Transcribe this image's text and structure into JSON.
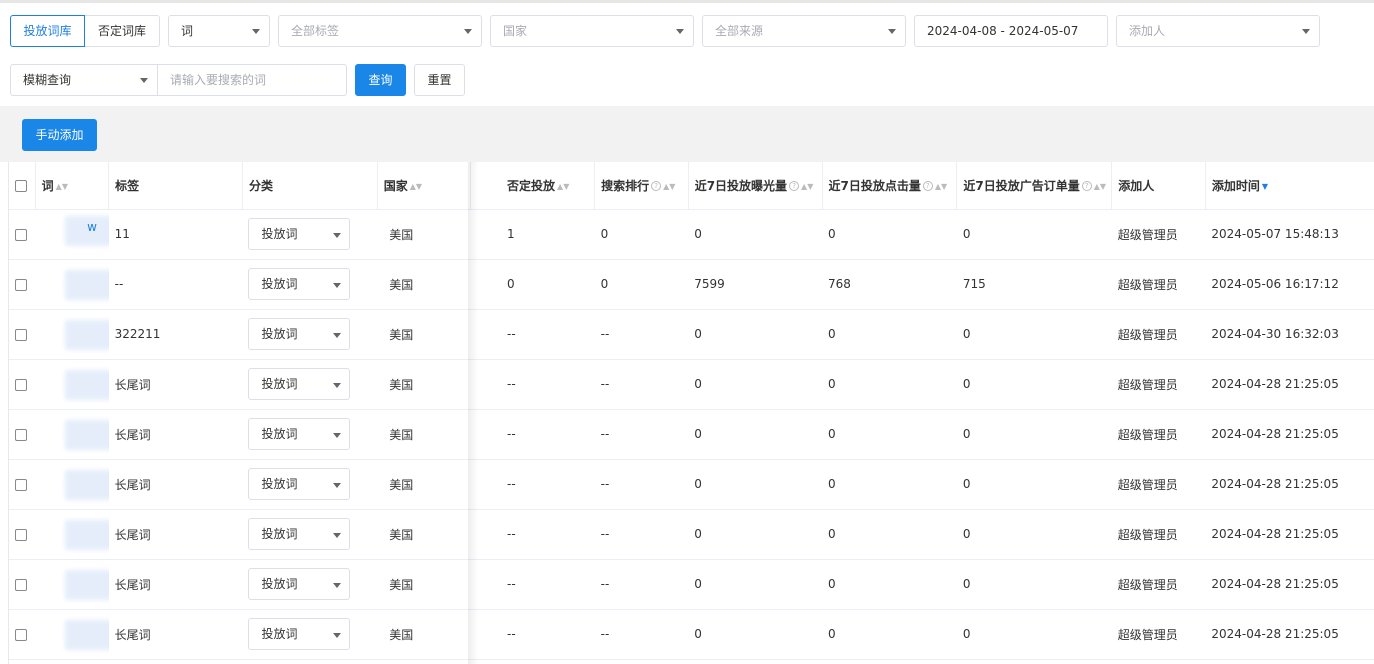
{
  "library_tabs": {
    "active": "投放词库",
    "other": "否定词库"
  },
  "filters": {
    "word_select": "词",
    "tag_select": "全部标签",
    "country_select": "国家",
    "source_select": "全部来源",
    "date_range": "2024-04-08 - 2024-05-07",
    "adder_select": "添加人",
    "match_mode": "模糊查询",
    "search_placeholder": "请输入要搜索的词",
    "query_button": "查询",
    "reset_button": "重置"
  },
  "toolbar": {
    "manual_add": "手动添加"
  },
  "columns": {
    "word": "词",
    "tag": "标签",
    "category": "分类",
    "country": "国家",
    "negative": "否定投放",
    "search_rank": "搜索排行",
    "impressions_7d": "近7日投放曝光量",
    "clicks_7d": "近7日投放点击量",
    "orders_7d": "近7日投放广告订单量",
    "adder": "添加人",
    "added_time": "添加时间"
  },
  "rows": [
    {
      "word": "w",
      "tag": "11",
      "category": "投放词",
      "country": "美国",
      "negative": "1",
      "search_rank": "0",
      "impressions": "0",
      "clicks": "0",
      "orders": "0",
      "adder": "超级管理员",
      "time": "2024-05-07 15:48:13"
    },
    {
      "word": "",
      "tag": "--",
      "category": "投放词",
      "country": "美国",
      "negative": "0",
      "search_rank": "0",
      "impressions": "7599",
      "clicks": "768",
      "orders": "715",
      "adder": "超级管理员",
      "time": "2024-05-06 16:17:12"
    },
    {
      "word": "",
      "tag": "322211",
      "category": "投放词",
      "country": "美国",
      "negative": "--",
      "search_rank": "--",
      "impressions": "0",
      "clicks": "0",
      "orders": "0",
      "adder": "超级管理员",
      "time": "2024-04-30 16:32:03"
    },
    {
      "word": "",
      "tag": "长尾词",
      "category": "投放词",
      "country": "美国",
      "negative": "--",
      "search_rank": "--",
      "impressions": "0",
      "clicks": "0",
      "orders": "0",
      "adder": "超级管理员",
      "time": "2024-04-28 21:25:05"
    },
    {
      "word": "",
      "tag": "长尾词",
      "category": "投放词",
      "country": "美国",
      "negative": "--",
      "search_rank": "--",
      "impressions": "0",
      "clicks": "0",
      "orders": "0",
      "adder": "超级管理员",
      "time": "2024-04-28 21:25:05"
    },
    {
      "word": "",
      "tag": "长尾词",
      "category": "投放词",
      "country": "美国",
      "negative": "--",
      "search_rank": "--",
      "impressions": "0",
      "clicks": "0",
      "orders": "0",
      "adder": "超级管理员",
      "time": "2024-04-28 21:25:05"
    },
    {
      "word": "",
      "tag": "长尾词",
      "category": "投放词",
      "country": "美国",
      "negative": "--",
      "search_rank": "--",
      "impressions": "0",
      "clicks": "0",
      "orders": "0",
      "adder": "超级管理员",
      "time": "2024-04-28 21:25:05"
    },
    {
      "word": "",
      "tag": "长尾词",
      "category": "投放词",
      "country": "美国",
      "negative": "--",
      "search_rank": "--",
      "impressions": "0",
      "clicks": "0",
      "orders": "0",
      "adder": "超级管理员",
      "time": "2024-04-28 21:25:05"
    },
    {
      "word": "",
      "tag": "长尾词",
      "category": "投放词",
      "country": "美国",
      "negative": "--",
      "search_rank": "--",
      "impressions": "0",
      "clicks": "0",
      "orders": "0",
      "adder": "超级管理员",
      "time": "2024-04-28 21:25:05"
    }
  ],
  "colors": {
    "primary": "#1a86e8",
    "border": "#dcdfe6",
    "toolbar_bg": "#f2f2f2"
  },
  "icons": {
    "sort": "sort-caret-icon",
    "help": "question-circle-icon",
    "dropdown": "chevron-down-icon"
  }
}
